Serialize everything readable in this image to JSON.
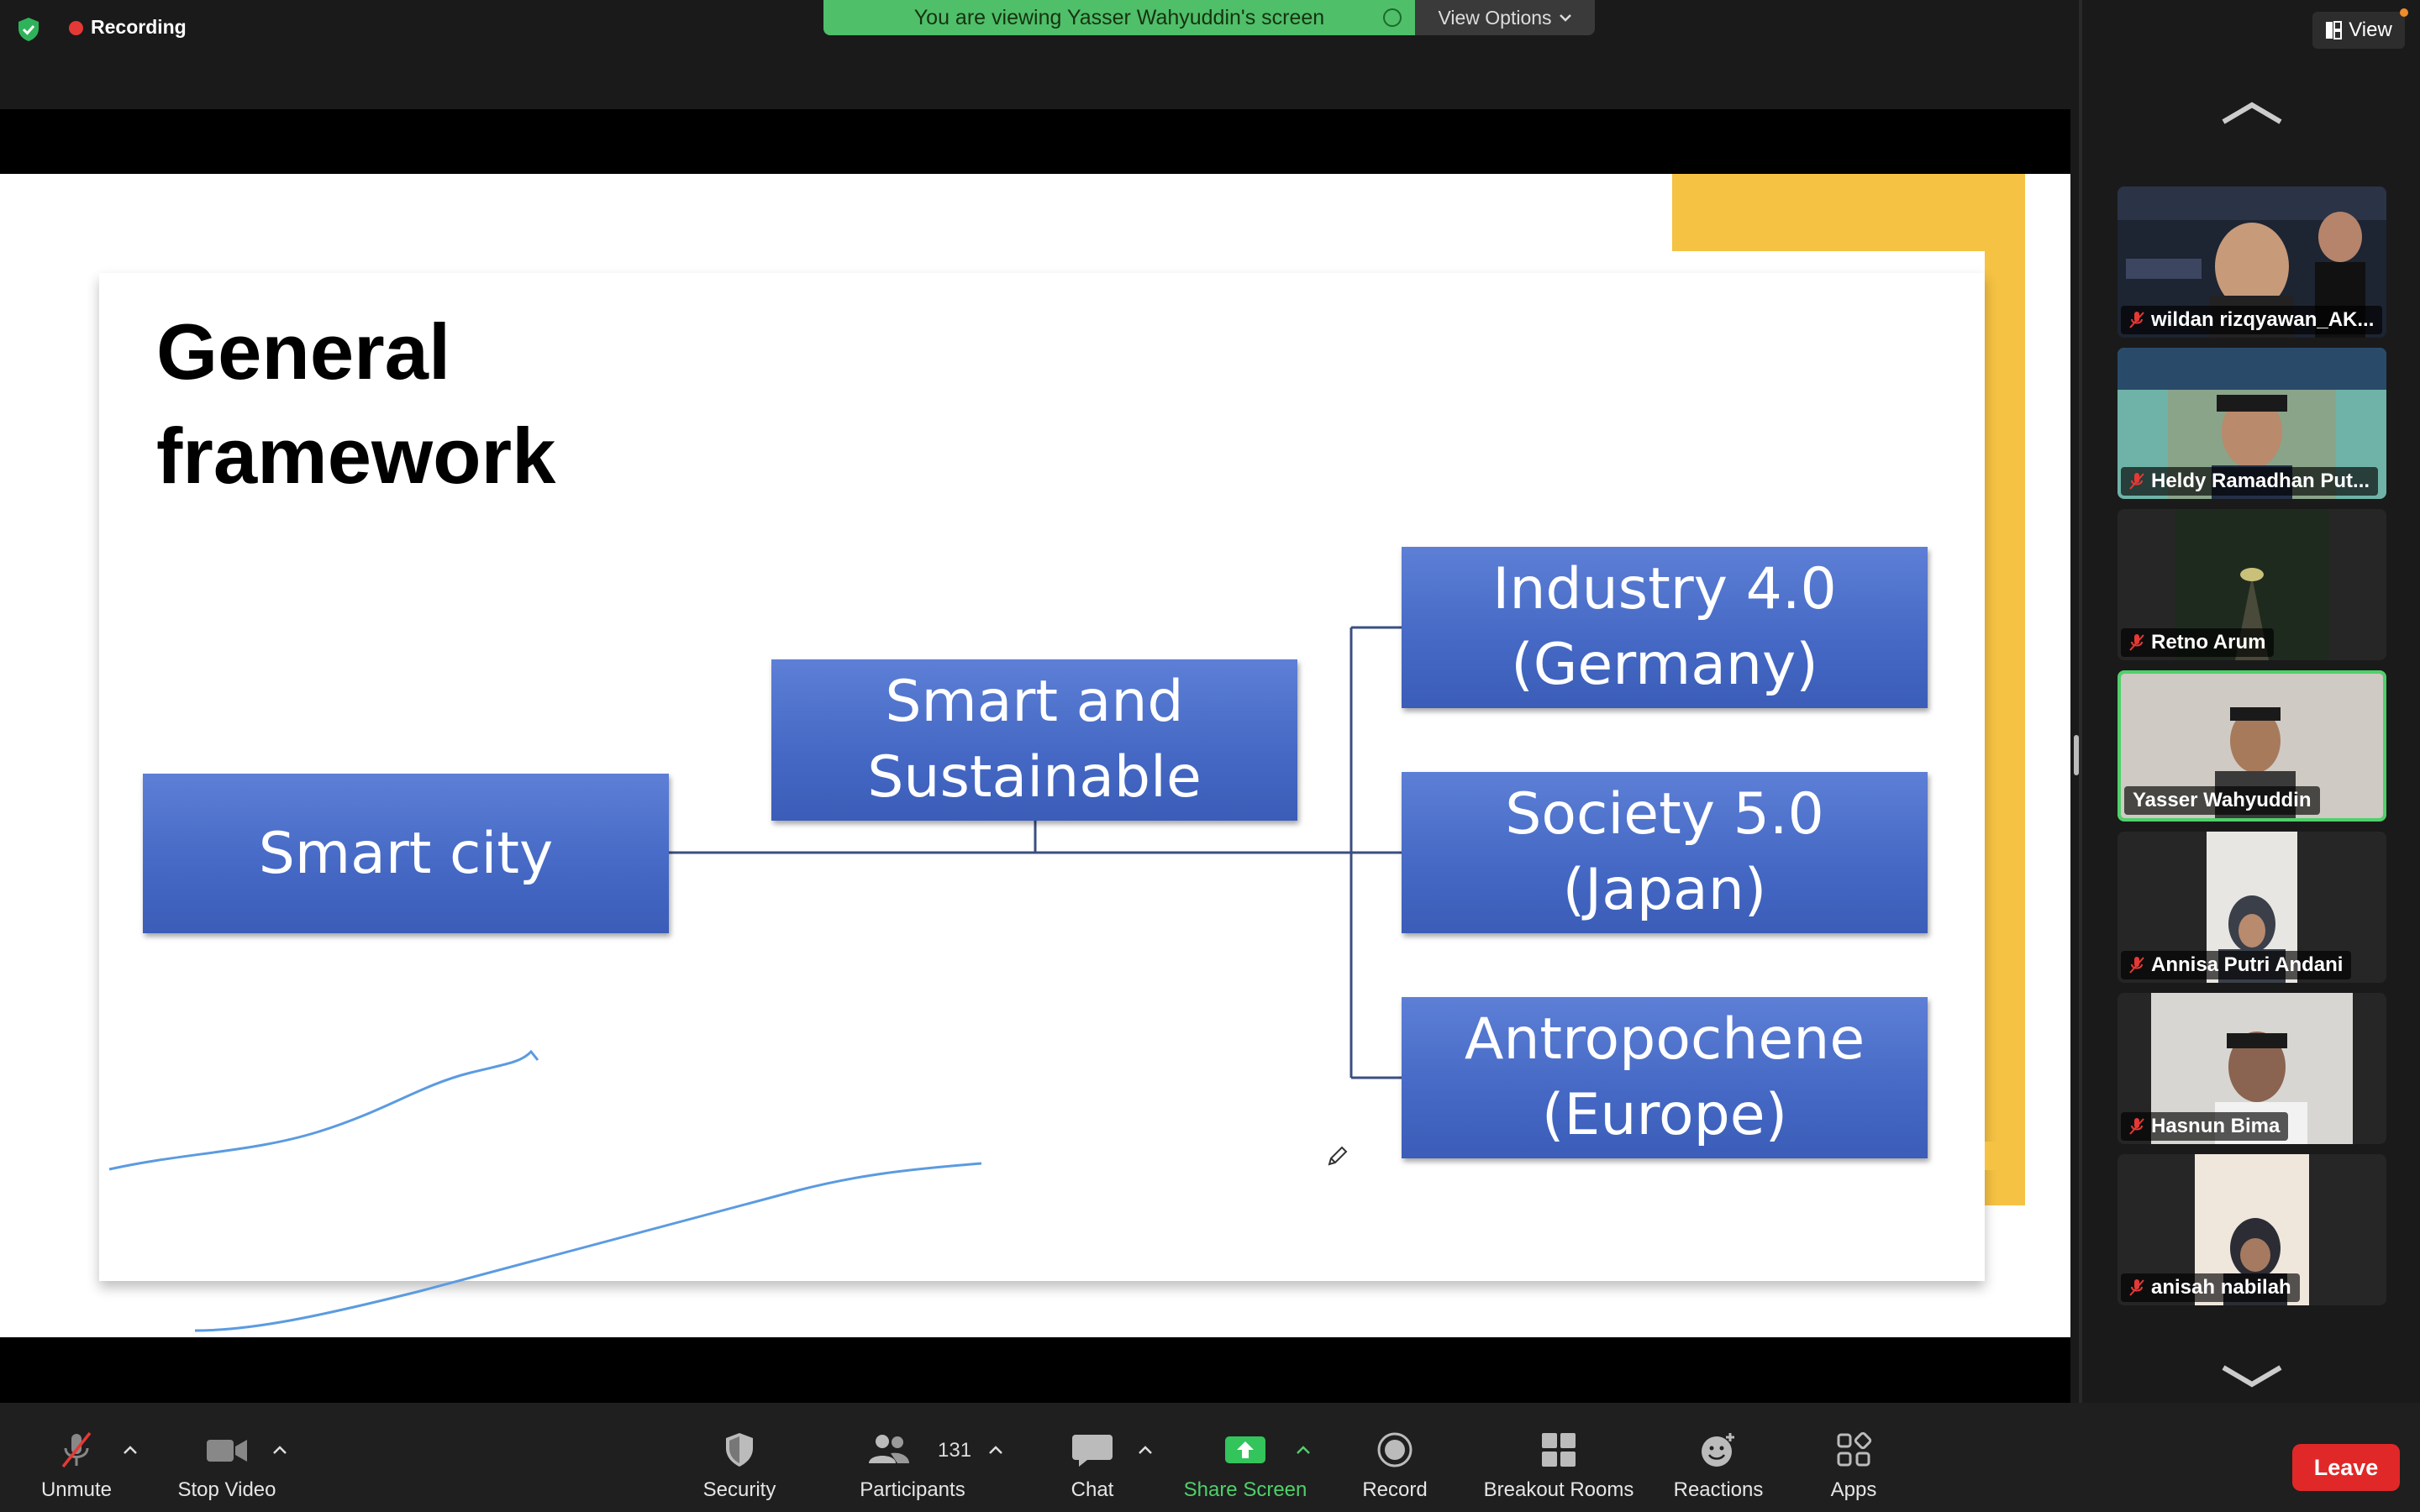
{
  "top_bar": {
    "recording_label": "Recording",
    "viewing_banner": "You are viewing Yasser Wahyuddin's screen",
    "view_options_label": "View Options"
  },
  "slide": {
    "title_line1": "General",
    "title_line2": "framework",
    "boxes": {
      "smart_city": "Smart city",
      "smart_sustainable": "Smart and\nSustainable",
      "industry": "Industry 4.0\n(Germany)",
      "society": "Society 5.0\n(Japan)",
      "antropochene": "Antropochene\n(Europe)"
    },
    "colors": {
      "box_blue": "#4468c4",
      "accent_yellow": "#f5c243",
      "annotation_line": "#5b9be0"
    }
  },
  "gallery": {
    "view_label": "View",
    "participants": [
      {
        "name": "wildan rizqyawan_AK...",
        "muted": true
      },
      {
        "name": "Heldy Ramadhan Put...",
        "muted": true
      },
      {
        "name": "Retno Arum",
        "muted": true
      },
      {
        "name": "Yasser Wahyuddin",
        "muted": false,
        "active": true
      },
      {
        "name": "Annisa Putri Andani",
        "muted": true
      },
      {
        "name": "Hasnun Bima",
        "muted": true
      },
      {
        "name": "anisah nabilah",
        "muted": true
      }
    ]
  },
  "toolbar": {
    "unmute": "Unmute",
    "stop_video": "Stop Video",
    "security": "Security",
    "participants": "Participants",
    "participants_count": "131",
    "chat": "Chat",
    "share_screen": "Share Screen",
    "record": "Record",
    "breakout_rooms": "Breakout Rooms",
    "reactions": "Reactions",
    "apps": "Apps",
    "leave": "Leave"
  }
}
